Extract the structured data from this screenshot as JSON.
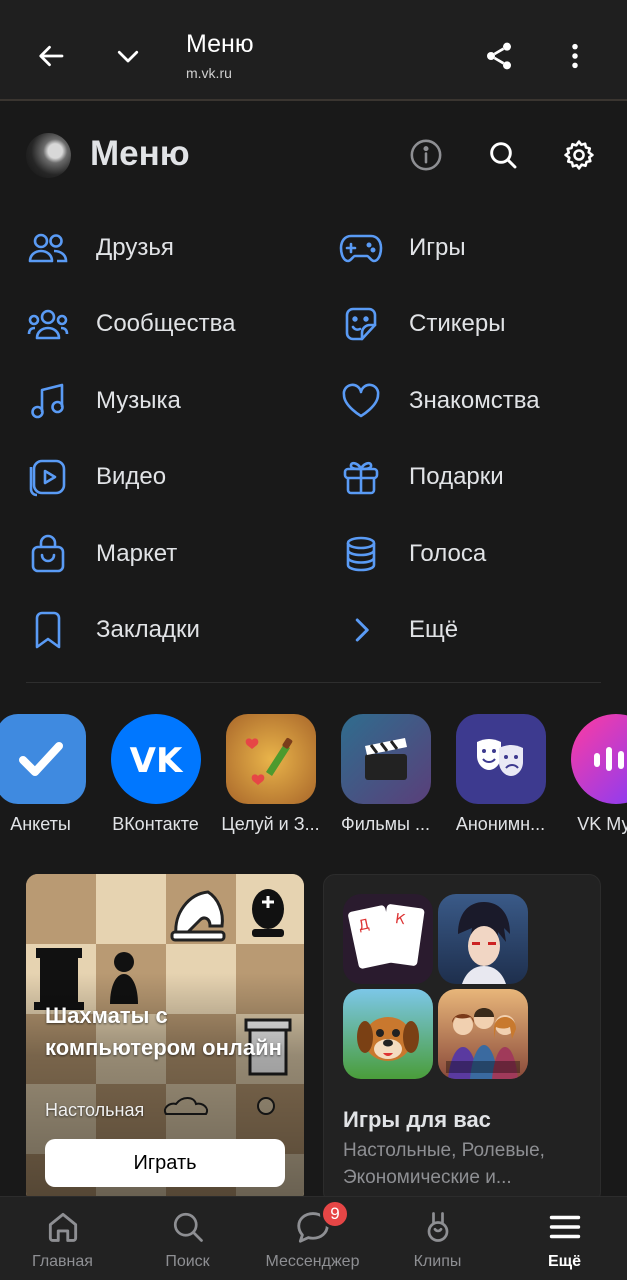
{
  "browser": {
    "title": "Меню",
    "url": "m.vk.ru"
  },
  "header": {
    "title": "Меню"
  },
  "menu": {
    "left": [
      {
        "label": "Друзья",
        "icon": "friends-icon"
      },
      {
        "label": "Сообщества",
        "icon": "communities-icon"
      },
      {
        "label": "Музыка",
        "icon": "music-icon"
      },
      {
        "label": "Видео",
        "icon": "video-icon"
      },
      {
        "label": "Маркет",
        "icon": "market-icon"
      },
      {
        "label": "Закладки",
        "icon": "bookmark-icon"
      }
    ],
    "right": [
      {
        "label": "Игры",
        "icon": "gamepad-icon"
      },
      {
        "label": "Стикеры",
        "icon": "sticker-icon"
      },
      {
        "label": "Знакомства",
        "icon": "heart-icon"
      },
      {
        "label": "Подарки",
        "icon": "gift-icon"
      },
      {
        "label": "Голоса",
        "icon": "coins-icon"
      },
      {
        "label": "Ещё",
        "icon": "chevron-right-icon"
      }
    ]
  },
  "apps": [
    {
      "label": "Анкеты"
    },
    {
      "label": "ВКонтакте"
    },
    {
      "label": "Целуй и З..."
    },
    {
      "label": "Фильмы ..."
    },
    {
      "label": "Анонимн..."
    },
    {
      "label": "VK Муз..."
    }
  ],
  "chess_card": {
    "title": "Шахматы с компьютером онлайн",
    "subtitle": "Настольная",
    "button": "Играть"
  },
  "games_card": {
    "title": "Игры для вас",
    "subtitle": "Настольные, Ролевые, Экономические и..."
  },
  "tabs": [
    {
      "label": "Главная",
      "icon": "home-icon"
    },
    {
      "label": "Поиск",
      "icon": "search-icon"
    },
    {
      "label": "Мессенджер",
      "icon": "messenger-icon",
      "badge": "9"
    },
    {
      "label": "Клипы",
      "icon": "clips-icon"
    },
    {
      "label": "Ещё",
      "icon": "menu-icon",
      "active": true
    }
  ],
  "colors": {
    "background": "#191919",
    "accent": "#5a9bf5",
    "text": "#e1e3e6",
    "secondary": "#8e8f93",
    "badge": "#e64646"
  }
}
